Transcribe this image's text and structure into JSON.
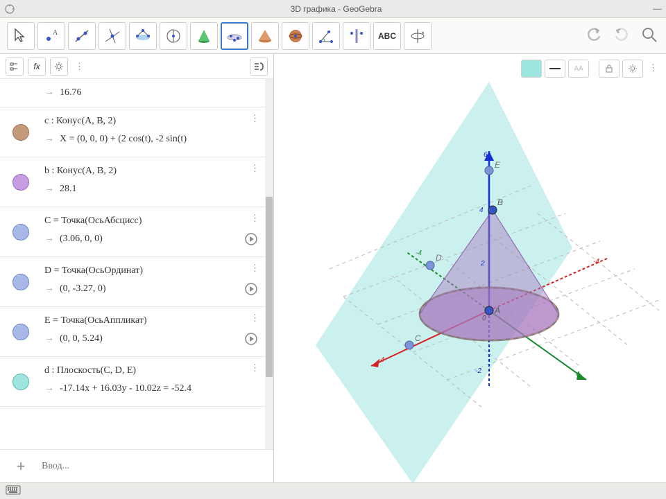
{
  "window": {
    "title": "3D графика - GeoGebra"
  },
  "toolbar": {
    "tools": [
      "pointer",
      "point",
      "line",
      "perpendicular",
      "polygon",
      "circle",
      "cone",
      "sphere-point",
      "pyramid",
      "sphere",
      "angle",
      "reflection",
      "text",
      "rotate-view"
    ],
    "text_label": "ABC"
  },
  "algebra": {
    "input_placeholder": "Ввод...",
    "rows": [
      {
        "type": "partial",
        "value": "16.76"
      },
      {
        "type": "full",
        "color": "#c49a7a",
        "def": "c : Конус(A, B, 2)",
        "value": "X = (0, 0, 0) + (2 cos(t), -2 sin(t)"
      },
      {
        "type": "full",
        "color": "#c69de0",
        "def": "b : Конус(A, B, 2)",
        "value": "28.1"
      },
      {
        "type": "full",
        "color": "#a8b9e8",
        "def": "C = Точка(ОсьАбсцисс)",
        "value": "(3.06, 0, 0)",
        "play": true
      },
      {
        "type": "full",
        "color": "#a8b9e8",
        "def": "D = Точка(ОсьОрдинат)",
        "value": "(0, -3.27, 0)",
        "play": true
      },
      {
        "type": "full",
        "color": "#a8b9e8",
        "def": "E = Точка(ОсьАппликат)",
        "value": "(0, 0, 5.24)",
        "play": true
      },
      {
        "type": "full",
        "color": "#9ee5df",
        "def": "d : Плоскость(C, D, E)",
        "value": "-17.14x + 16.03y - 10.02z = -52.4"
      }
    ]
  },
  "view3d": {
    "labels": {
      "A": "A",
      "B": "B",
      "C": "C",
      "D": "D",
      "E": "E"
    },
    "ticks": {
      "z_top": "6",
      "z_mid": "4",
      "z_in": "2",
      "z_neg": "-2",
      "y1": "-4",
      "y2": "4",
      "x1": "-4",
      "x2": "-4",
      "origin": "0"
    }
  }
}
